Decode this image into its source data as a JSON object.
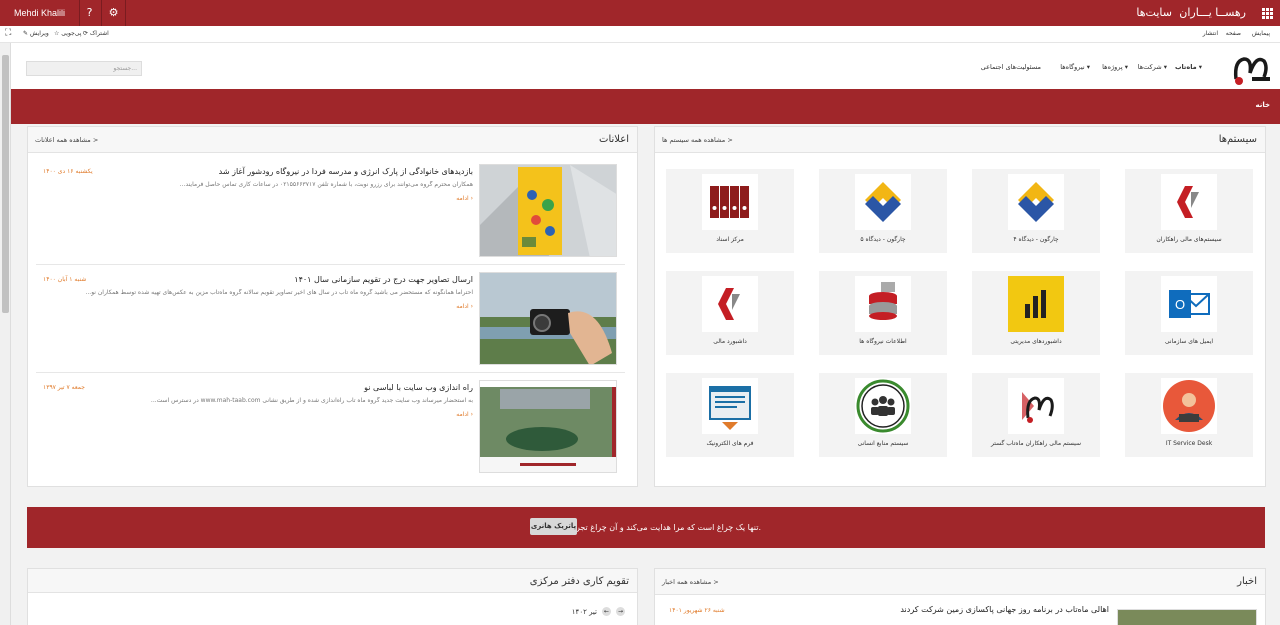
{
  "suitebar": {
    "brand": "رهســا یـــاران",
    "sites": "سایت‌ها",
    "user": "Mehdi Khalili",
    "help": "?",
    "settings": "⚙"
  },
  "ribbon": {
    "browse": "پیمایش",
    "page": "صفحه",
    "publish": "انتشار",
    "share": "اشتراک",
    "follow": "پی‌جویی",
    "edit": "ویرایش"
  },
  "nav": {
    "items": [
      "ماه‌تاب",
      "شرکت‌ها",
      "پروژه‌ها",
      "نیروگاه‌ها",
      "مسئولیت‌های اجتماعی"
    ]
  },
  "search": {
    "placeholder": "جستجو..."
  },
  "breadcrumb": "خانه",
  "systems": {
    "title": "سیستم‌ها",
    "more": "مشاهده همه سیستم ها >",
    "tiles": [
      "سیستم‌های مالی راهکاران",
      "چارگون - دیدگاه ۴",
      "چارگون - دیدگاه ۵",
      "مرکز اسناد",
      "ایمیل های سازمانی",
      "داشبوردهای مدیریتی",
      "اطلاعات نیروگاه ها",
      "داشبورد مالی",
      "IT Service Desk",
      "سیستم مالی راهکاران ماه‌تاب گستر",
      "سیستم منابع انسانی",
      "فرم های الکترونیک"
    ]
  },
  "announcements": {
    "title": "اعلانات",
    "more": "مشاهده همه اعلانات >",
    "items": [
      {
        "title": "بازدیدهای خانوادگی از پارک انرژی و مدرسه فردا در نیروگاه رودشور آغاز شد",
        "date": "یکشنبه ۱۶ دی ۱۴۰۰",
        "excerpt": "همکاران محترم گروه می‌توانند برای رزرو نوبت، با شماره تلفن ۰۲۱۵۵۶۶۳۷۱۷ در ساعات کاری تماس حاصل فرمایند...",
        "more": "ادامه ›"
      },
      {
        "title": "ارسال تصاویر جهت درج در تقویم سازمانی سال ۱۴۰۱",
        "date": "شنبه ۱ آبان ۱۴۰۰",
        "excerpt": "احتراماً همانگونه که مستحضر می باشید گروه ماه تاب در سال های اخیر تصاویر تقویم سالانه گروه ماه‌تاب مزین به عکس‌های تهیه شده توسط همکاران نو...",
        "more": "ادامه ›"
      },
      {
        "title": "راه اندازی وب سایت با لباسی نو",
        "date": "جمعه ۷ تیر ۱۳۹۷",
        "excerpt": "به استحضار میرساند وب سایت جدید گروه ماه تاب راه‌اندازی شده و از طریق نشانی www.mah-taab.com در دسترس است...",
        "more": "ادامه ›"
      }
    ]
  },
  "quote": {
    "text": "تنها یک چراغ است که مرا هدایت می‌کند و آن چراغ تجربه است.",
    "author": "پاتریک هانری"
  },
  "news": {
    "title": "اخبار",
    "more": "مشاهده همه اخبار >",
    "item_title": "اهالی ماه‌تاب در برنامه روز جهانی پاکسازی زمین شرکت کردند",
    "item_date": "شنبه ۲۶ شهریور ۱۴۰۱"
  },
  "calendar": {
    "title": "تقویم کاری دفتر مرکزی",
    "month": "تیر ۱۴۰۲"
  }
}
